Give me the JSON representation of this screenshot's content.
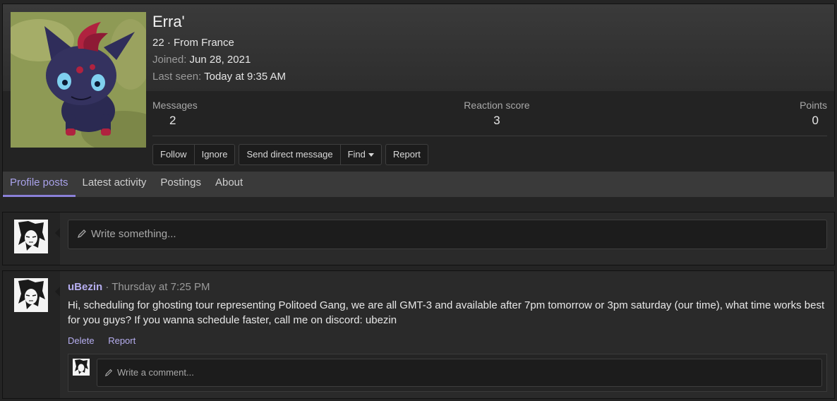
{
  "profile": {
    "username": "Erra'",
    "age_location": "22 · From France",
    "joined_label": "Joined:",
    "joined_value": "Jun 28, 2021",
    "last_seen_label": "Last seen:",
    "last_seen_value": "Today at 9:35 AM",
    "stats": {
      "messages_label": "Messages",
      "messages_value": "2",
      "reaction_label": "Reaction score",
      "reaction_value": "3",
      "points_label": "Points",
      "points_value": "0"
    },
    "buttons": {
      "follow": "Follow",
      "ignore": "Ignore",
      "send_dm": "Send direct message",
      "find": "Find",
      "report": "Report"
    },
    "tabs": [
      "Profile posts",
      "Latest activity",
      "Postings",
      "About"
    ]
  },
  "composer": {
    "placeholder": "Write something..."
  },
  "post": {
    "author": "uBezin",
    "separator": " · ",
    "time": "Thursday at 7:25 PM",
    "body": "Hi, scheduling for ghosting tour representing Politoed Gang, we are all GMT-3 and available after 7pm tomorrow or 3pm saturday (our time), what time works best for you guys? If you wanna schedule faster, call me on discord: ubezin",
    "actions": {
      "delete": "Delete",
      "report": "Report"
    },
    "comment_placeholder": "Write a comment..."
  },
  "colors": {
    "accent": "#8a80d8",
    "link": "#b6aef0",
    "background": "#242424"
  },
  "icons": [
    "pencil-icon",
    "caret-down-icon"
  ]
}
